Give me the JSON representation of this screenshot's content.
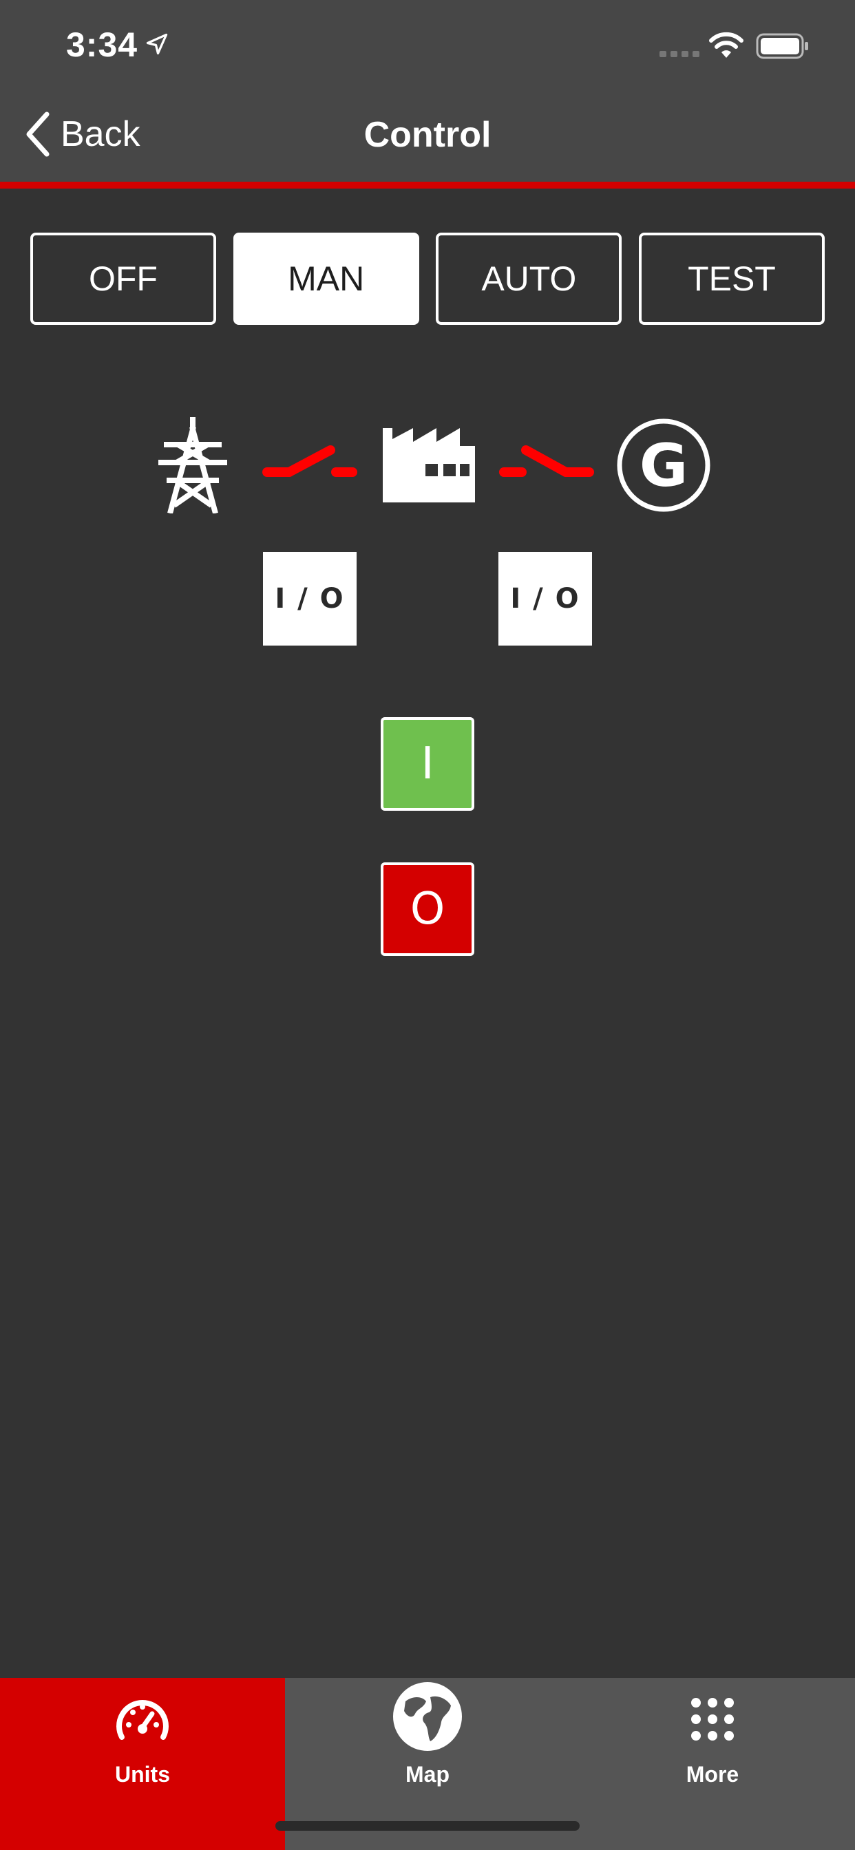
{
  "status_bar": {
    "time": "3:34"
  },
  "nav": {
    "back_label": "Back",
    "title": "Control"
  },
  "modes": [
    {
      "label": "OFF",
      "active": false
    },
    {
      "label": "MAN",
      "active": true
    },
    {
      "label": "AUTO",
      "active": false
    },
    {
      "label": "TEST",
      "active": false
    }
  ],
  "diagram": {
    "mains_icon": "power-pylon-icon",
    "load_icon": "factory-icon",
    "generator_icon": "generator-icon",
    "generator_letter": "G",
    "mains_breaker_button": "I / O",
    "generator_breaker_button": "I / O",
    "breaker_color": "#ff0000"
  },
  "controls": {
    "start_label": "I",
    "stop_label": "O",
    "start_color": "#6fc04e",
    "stop_color": "#d40000"
  },
  "tabs": [
    {
      "label": "Units",
      "icon": "speedometer-icon",
      "active": true
    },
    {
      "label": "Map",
      "icon": "globe-icon",
      "active": false
    },
    {
      "label": "More",
      "icon": "grid-icon",
      "active": false
    }
  ],
  "colors": {
    "accent": "#d40000",
    "background": "#333333",
    "header": "#474747",
    "tabbar": "#555555"
  }
}
